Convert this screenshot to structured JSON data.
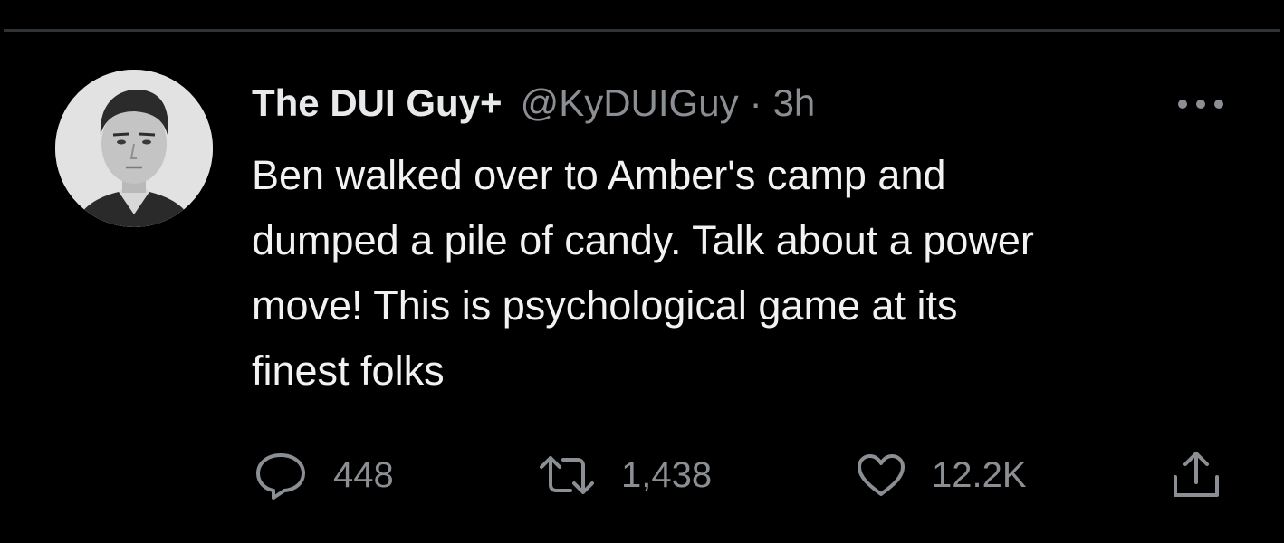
{
  "tweet": {
    "display_name": "The DUI Guy+",
    "handle": "@KyDUIGuy",
    "separator": "·",
    "timestamp": "3h",
    "text_lines": [
      "Ben walked over to Amber's camp and",
      "dumped a pile of candy. Talk about a power",
      "move! This is psychological game at its",
      "finest folks"
    ]
  },
  "stats": {
    "replies": "448",
    "retweets": "1,438",
    "likes": "12.2K"
  },
  "icons": {
    "avatar": "profile-photo",
    "more": "more-dots-icon",
    "reply": "reply-icon",
    "retweet": "retweet-icon",
    "like": "heart-icon",
    "share": "share-icon"
  },
  "colors": {
    "background": "#000000",
    "text_primary": "#e7e9ea",
    "text_secondary": "#8b8f93",
    "divider": "#2f3336"
  }
}
